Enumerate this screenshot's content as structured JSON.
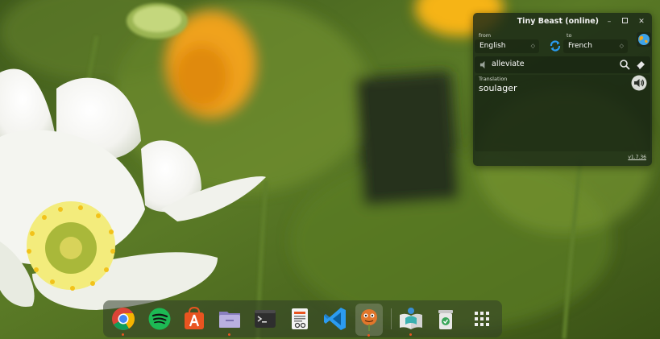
{
  "window": {
    "title": "Tiny Beast (online)",
    "from_label": "from",
    "to_label": "to",
    "source_language": "English",
    "target_language": "French",
    "input_text": "alleviate",
    "translation_label": "Translation",
    "translation_text": "soulager",
    "version": "v1.7.36",
    "controls": {
      "minimize": "–",
      "close": "✕"
    }
  },
  "dock": {
    "apps": [
      {
        "name": "Google Chrome",
        "icon": "chrome-icon"
      },
      {
        "name": "Spotify",
        "icon": "spotify-icon"
      },
      {
        "name": "App Center",
        "icon": "app-store-icon"
      },
      {
        "name": "Files",
        "icon": "files-icon"
      },
      {
        "name": "Terminal",
        "icon": "terminal-icon"
      },
      {
        "name": "Text Editor",
        "icon": "text-editor-icon"
      },
      {
        "name": "Visual Studio Code",
        "icon": "vscode-icon"
      },
      {
        "name": "Tiny Beast",
        "icon": "tiny-beast-icon"
      },
      {
        "name": "Dictionary",
        "icon": "book-reader-icon"
      },
      {
        "name": "Trash",
        "icon": "trash-icon"
      },
      {
        "name": "Show Applications",
        "icon": "app-grid-icon"
      }
    ],
    "colors": {
      "running_dot": "#e95420",
      "accent_chrome": "#4285f4",
      "spotify": "#1db954",
      "vscode": "#2b9bf0"
    }
  }
}
